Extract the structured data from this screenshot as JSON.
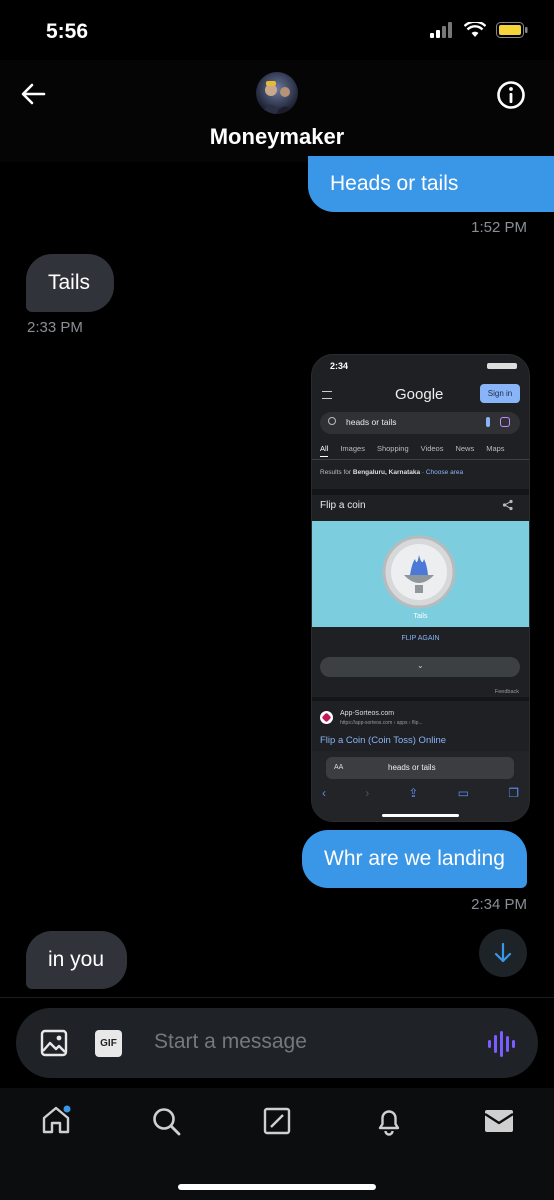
{
  "status": {
    "time": "5:56"
  },
  "header": {
    "name": "Moneymaker"
  },
  "messages": [
    {
      "dir": "out",
      "text": "Heads or tails",
      "time": "1:52 PM"
    },
    {
      "dir": "in",
      "text": "Tails",
      "time": "2:33 PM"
    },
    {
      "dir": "out",
      "text": "Whr are we landing",
      "time": "2:34 PM"
    },
    {
      "dir": "in",
      "text": "in you"
    }
  ],
  "screenshot": {
    "time": "2:34",
    "logo": "Google",
    "sign_in": "Sign in",
    "query": "heads or tails",
    "tabs": [
      "All",
      "Images",
      "Shopping",
      "Videos",
      "News",
      "Maps"
    ],
    "results_for_prefix": "Results for",
    "results_location": "Bengaluru, Karnataka",
    "choose_area": "Choose area",
    "card_title": "Flip a coin",
    "coin_result": "Tails",
    "flip_again": "FLIP AGAIN",
    "feedback": "Feedback",
    "result_site": "App-Sorteos.com",
    "result_url": "https://app-sorteos.com › apps › flip...",
    "result_title": "Flip a Coin (Coin Toss) Online",
    "addr_aa": "AA",
    "addr_text": "heads or tails"
  },
  "composer": {
    "placeholder": "Start a message",
    "gif_label": "GIF"
  },
  "colors": {
    "accent": "#3a96e6",
    "incoming": "#30343a",
    "voice": "#7a5cff"
  }
}
